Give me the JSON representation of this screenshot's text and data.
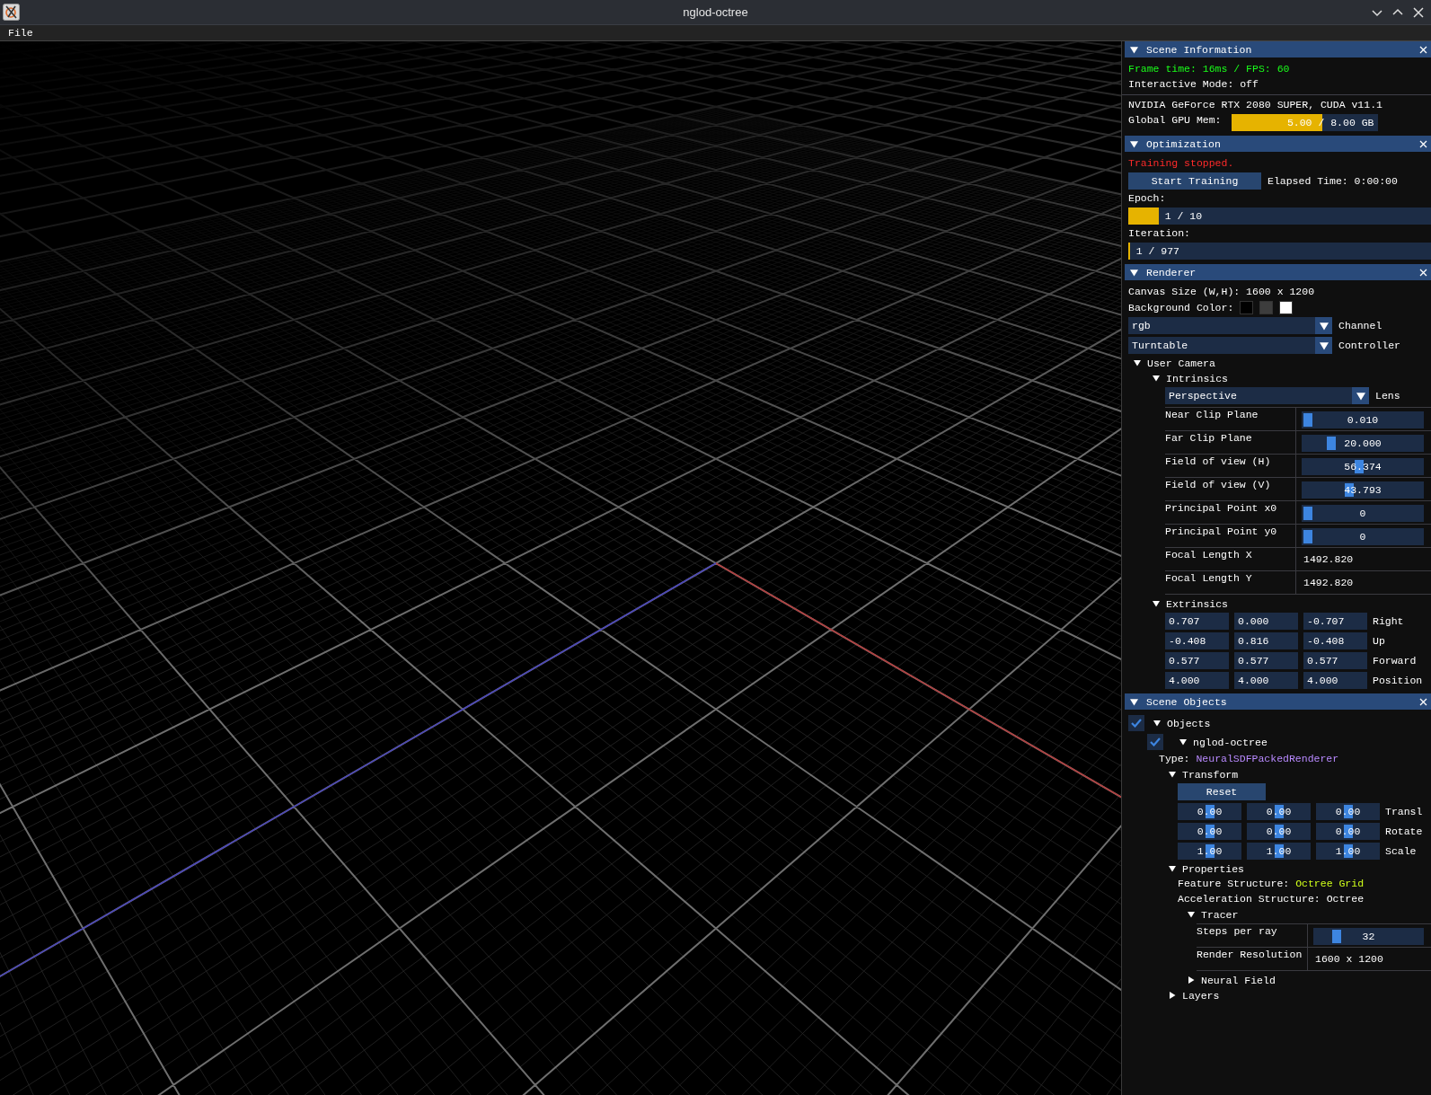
{
  "window": {
    "title": "nglod-octree"
  },
  "menu": [
    {
      "label": "File"
    }
  ],
  "scene_information": {
    "title": "Scene Information",
    "expanded": true,
    "frame_time": "Frame time: 16ms / FPS: 60",
    "interactive_mode": "Interactive Mode: off",
    "gpu": "NVIDIA GeForce RTX 2080 SUPER, CUDA v11.1",
    "gpu_mem": {
      "label": "Global GPU Mem:",
      "reading": "5.00 / 8.00 GB",
      "level": 0.625
    }
  },
  "optimization": {
    "title": "Optimization",
    "expanded": true,
    "status": "Training stopped.",
    "start_button": "Start Training",
    "elapsed": "Elapsed Time: 0:00:00",
    "epoch": {
      "label": "Epoch:",
      "reading": "1 / 10",
      "level": 0.1
    },
    "iteration": {
      "label": "Iteration:",
      "reading": "1 / 977",
      "level": 0.005
    }
  },
  "renderer": {
    "title": "Renderer",
    "expanded": true,
    "canvas_size": "Canvas Size (W,H): 1600 x 1200",
    "background_color": {
      "label": "Background Color:",
      "swatches": [
        {
          "color": "#000000"
        },
        {
          "color": "#3d3d3d"
        },
        {
          "color": "#ffffff"
        }
      ]
    },
    "combos": [
      {
        "value": "rgb",
        "label": "Channel"
      },
      {
        "value": "Turntable",
        "label": "Controller"
      }
    ],
    "user_camera": {
      "label": "User Camera",
      "expanded": true,
      "intrinsics": {
        "label": "Intrinsics",
        "expanded": true,
        "lens": {
          "value": "Perspective",
          "label": "Lens"
        },
        "rows": [
          {
            "label": "Near Clip Plane",
            "kind": "slider",
            "value": "0.010",
            "level": 0.0
          },
          {
            "label": "Far Clip Plane",
            "kind": "slider",
            "value": "20.000",
            "level": 0.21
          },
          {
            "label": "Field of view (H)",
            "kind": "slider",
            "value": "56.374",
            "level": 0.47
          },
          {
            "label": "Field of view (V)",
            "kind": "slider",
            "value": "43.793",
            "level": 0.38
          },
          {
            "label": "Principal Point x0",
            "kind": "slider",
            "value": "0",
            "level": 0.0
          },
          {
            "label": "Principal Point y0",
            "kind": "slider",
            "value": "0",
            "level": 0.0
          },
          {
            "label": "Focal Length X",
            "kind": "text",
            "value": "1492.820"
          },
          {
            "label": "Focal Length Y",
            "kind": "text",
            "value": "1492.820"
          }
        ]
      },
      "extrinsics": {
        "label": "Extrinsics",
        "expanded": true,
        "rows": [
          {
            "label": "Right",
            "values": [
              "0.707",
              "0.000",
              "-0.707"
            ]
          },
          {
            "label": "Up",
            "values": [
              "-0.408",
              "0.816",
              "-0.408"
            ]
          },
          {
            "label": "Forward",
            "values": [
              "0.577",
              "0.577",
              "0.577"
            ]
          },
          {
            "label": "Position",
            "values": [
              "4.000",
              "4.000",
              "4.000"
            ]
          }
        ]
      }
    }
  },
  "scene_objects": {
    "title": "Scene Objects",
    "expanded": true,
    "objects": {
      "label": "Objects",
      "checked": true,
      "expanded": true,
      "items": [
        {
          "label": "nglod-octree",
          "checked": true,
          "expanded": true,
          "type_label": "Type:",
          "type_value": "NeuralSDFPackedRenderer",
          "transform": {
            "label": "Transform",
            "expanded": true,
            "reset_button": "Reset",
            "rows": [
              {
                "label": "Transl",
                "values": [
                  {
                    "value": "0.00",
                    "level": 0.5
                  },
                  {
                    "value": "0.00",
                    "level": 0.5
                  },
                  {
                    "value": "0.00",
                    "level": 0.5
                  }
                ]
              },
              {
                "label": "Rotate",
                "values": [
                  {
                    "value": "0.00",
                    "level": 0.5
                  },
                  {
                    "value": "0.00",
                    "level": 0.5
                  },
                  {
                    "value": "0.00",
                    "level": 0.5
                  }
                ]
              },
              {
                "label": "Scale",
                "values": [
                  {
                    "value": "1.00",
                    "level": 0.5
                  },
                  {
                    "value": "1.00",
                    "level": 0.5
                  },
                  {
                    "value": "1.00",
                    "level": 0.5
                  }
                ]
              }
            ]
          },
          "properties": {
            "label": "Properties",
            "expanded": true,
            "feature_label": "Feature Structure:",
            "feature_value": "Octree Grid",
            "acceleration": "Acceleration Structure: Octree",
            "tracer": {
              "label": "Tracer",
              "expanded": true,
              "rows": [
                {
                  "label": "Steps per ray",
                  "kind": "slider",
                  "value": "32",
                  "level": 0.17
                },
                {
                  "label": "Render Resolution",
                  "kind": "text",
                  "value": "1600 x 1200"
                }
              ]
            },
            "neural_field": {
              "label": "Neural Field",
              "expanded": false
            }
          },
          "layers": {
            "label": "Layers",
            "expanded": false
          }
        }
      ]
    }
  }
}
